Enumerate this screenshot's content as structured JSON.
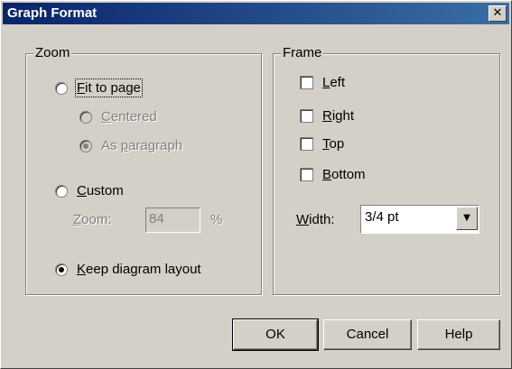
{
  "window": {
    "title": "Graph Format",
    "close_glyph": "✕"
  },
  "zoom_group": {
    "label": "Zoom",
    "fit_to_page": {
      "label": "Fit to page",
      "mnemonic": "F",
      "rest": "it to page",
      "selected": false
    },
    "centered": {
      "mnemonic": "C",
      "rest": "entered",
      "selected": false,
      "enabled": false
    },
    "as_paragraph": {
      "prefix": "As ",
      "mnemonic": "p",
      "rest": "aragraph",
      "selected": true,
      "enabled": false
    },
    "custom": {
      "mnemonic": "C",
      "rest": "ustom",
      "selected": false
    },
    "zoom_field": {
      "label_mnemonic": "Z",
      "label_rest": "oom:",
      "value": "84",
      "unit": "%",
      "enabled": false
    },
    "keep_layout": {
      "mnemonic": "K",
      "rest": "eep diagram layout",
      "selected": true
    }
  },
  "frame_group": {
    "label": "Frame",
    "left": {
      "mnemonic": "L",
      "rest": "eft",
      "checked": false
    },
    "right": {
      "mnemonic": "R",
      "rest": "ight",
      "checked": false
    },
    "top": {
      "mnemonic": "T",
      "rest": "op",
      "checked": false
    },
    "bottom": {
      "mnemonic": "B",
      "rest": "ottom",
      "checked": false
    },
    "width": {
      "label_mnemonic": "W",
      "label_rest": "idth:",
      "value": "3/4 pt"
    }
  },
  "buttons": {
    "ok": "OK",
    "cancel": "Cancel",
    "help": "Help"
  },
  "icons": {
    "dropdown": "chevron-down-icon",
    "close": "close-icon"
  }
}
